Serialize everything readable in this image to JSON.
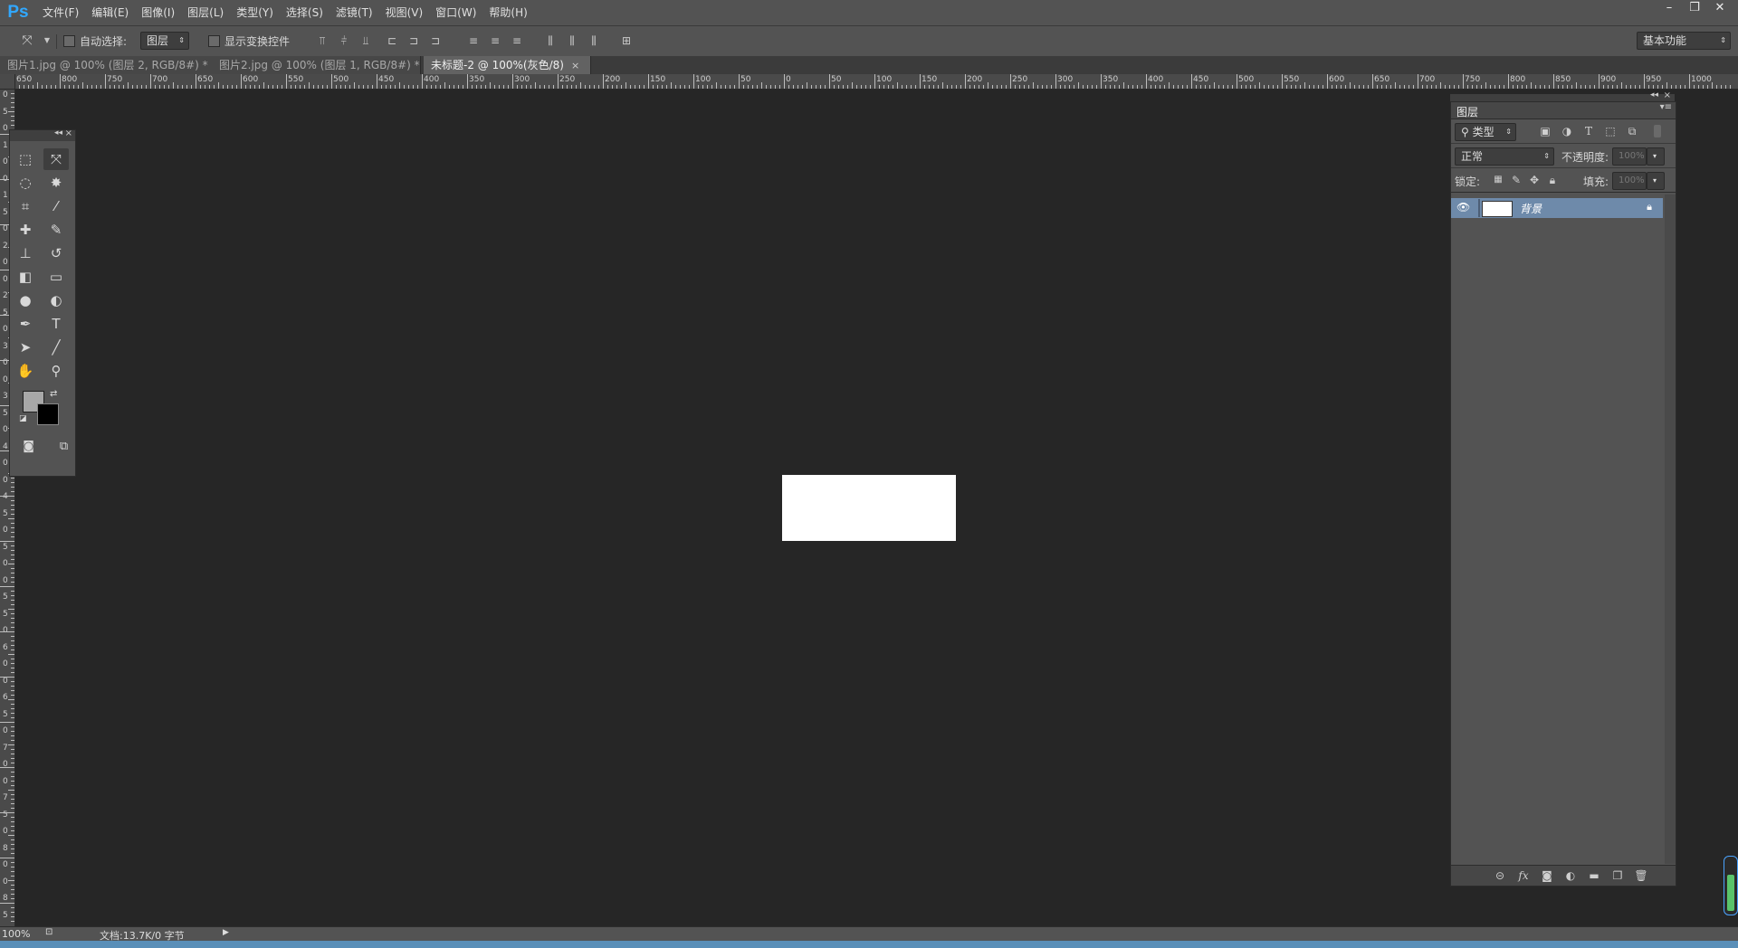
{
  "app": {
    "logo": "Ps"
  },
  "menu": [
    "文件(F)",
    "编辑(E)",
    "图像(I)",
    "图层(L)",
    "类型(Y)",
    "选择(S)",
    "滤镜(T)",
    "视图(V)",
    "窗口(W)",
    "帮助(H)"
  ],
  "window_controls": {
    "minimize": "–",
    "restore": "❐",
    "close": "✕"
  },
  "options": {
    "auto_select_label": "自动选择:",
    "auto_select_value": "图层",
    "show_transform_label": "显示变换控件",
    "workspace": "基本功能"
  },
  "tabs": [
    {
      "label": "图片1.jpg @ 100% (图层 2, RGB/8#) *",
      "close": "×",
      "active": false
    },
    {
      "label": "图片2.jpg @ 100% (图层 1, RGB/8#) *",
      "close": "×",
      "active": false
    },
    {
      "label": "未标题-2 @ 100%(灰色/8)",
      "close": "×",
      "active": true
    }
  ],
  "ruler": {
    "h_labels": [
      "650",
      "800",
      "750",
      "700",
      "650",
      "600",
      "550",
      "500",
      "450",
      "400",
      "350",
      "300",
      "250",
      "200",
      "150",
      "100",
      "50",
      "0",
      "50",
      "100",
      "150",
      "200",
      "250",
      "300",
      "350",
      "400",
      "450",
      "500",
      "550",
      "600",
      "650",
      "700",
      "750",
      "800",
      "850",
      "900",
      "950",
      "1000"
    ],
    "v_labels": [
      "0",
      "5",
      "0",
      "1",
      "0",
      "0",
      "1",
      "5",
      "0",
      "2",
      "0",
      "0",
      "2",
      "5",
      "0",
      "3",
      "0",
      "0",
      "3",
      "5",
      "0",
      "4",
      "0",
      "0",
      "4",
      "5",
      "0",
      "5",
      "0",
      "0",
      "5",
      "5",
      "0",
      "6",
      "0",
      "0",
      "6",
      "5",
      "0",
      "7",
      "0",
      "0",
      "7",
      "5",
      "0",
      "8",
      "0",
      "0",
      "8",
      "5",
      "0"
    ]
  },
  "toolbox": {
    "tools": [
      {
        "name": "rect-marquee",
        "glyph": "⬚"
      },
      {
        "name": "move",
        "glyph": "⤧"
      },
      {
        "name": "lasso",
        "glyph": "◌"
      },
      {
        "name": "magic-wand",
        "glyph": "✸"
      },
      {
        "name": "crop",
        "glyph": "⌗"
      },
      {
        "name": "eyedropper",
        "glyph": "⁄"
      },
      {
        "name": "healing",
        "glyph": "✚"
      },
      {
        "name": "brush",
        "glyph": "✎"
      },
      {
        "name": "clone-stamp",
        "glyph": "⊥"
      },
      {
        "name": "history-brush",
        "glyph": "↺"
      },
      {
        "name": "eraser",
        "glyph": "◧"
      },
      {
        "name": "gradient",
        "glyph": "▭"
      },
      {
        "name": "blur",
        "glyph": "●"
      },
      {
        "name": "dodge",
        "glyph": "◐"
      },
      {
        "name": "pen",
        "glyph": "✒"
      },
      {
        "name": "type",
        "glyph": "T"
      },
      {
        "name": "path-select",
        "glyph": "➤"
      },
      {
        "name": "line",
        "glyph": "╱"
      },
      {
        "name": "hand",
        "glyph": "✋"
      },
      {
        "name": "zoom",
        "glyph": "⚲"
      }
    ],
    "fg_color": "#a8a8a8",
    "bg_color": "#000000"
  },
  "layers": {
    "title": "图层",
    "filter": "类型",
    "blend_mode": "正常",
    "opacity_label": "不透明度:",
    "opacity_value": "100%",
    "lock_label": "锁定:",
    "fill_label": "填充:",
    "fill_value": "100%",
    "items": [
      {
        "name": "背景"
      }
    ]
  },
  "status": {
    "zoom": "100%",
    "doc": "文档:13.7K/0 字节"
  },
  "colors": {
    "accent": "#31a8ff",
    "canvas": "#ffffff",
    "workspace": "#262626",
    "layer_selected": "#6e8aaa"
  }
}
